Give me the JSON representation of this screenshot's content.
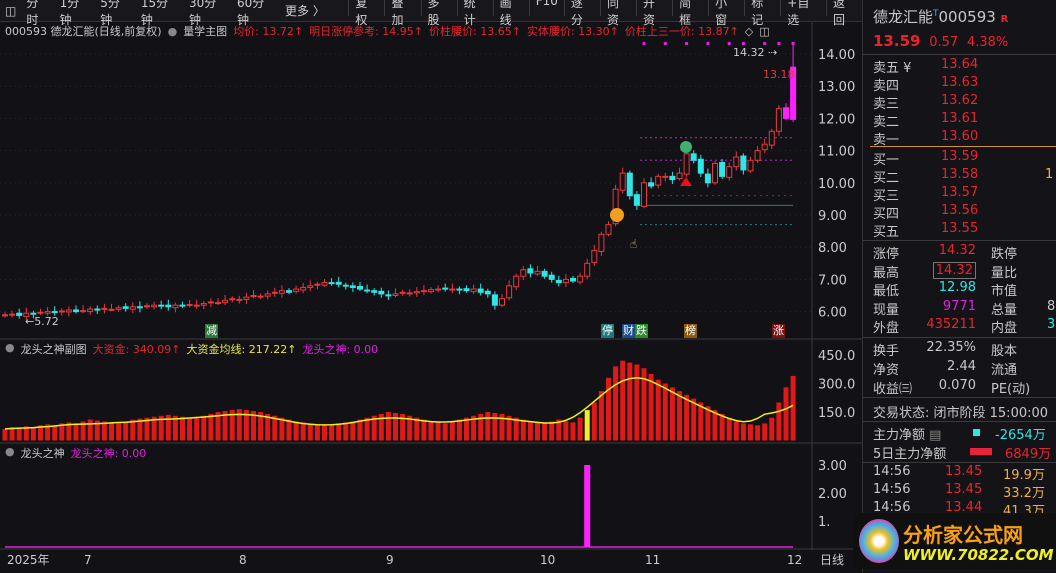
{
  "toolbar": {
    "items": [
      "分时",
      "1分钟",
      "5分钟",
      "15分钟",
      "30分钟",
      "60分钟"
    ],
    "more": "更多 〉",
    "tools": [
      "复权",
      "叠加",
      "多股",
      "统计",
      "画线",
      "F10",
      "逐分",
      "同资",
      "开资",
      "简框",
      "小窗",
      "标记",
      "+自选",
      "返回"
    ]
  },
  "info": {
    "title": "000593 德龙汇能(日线,前复权)",
    "indicator": "量学主图",
    "avg": "均价: 13.72↑",
    "limit_ref": "明日涨停参考: 14.95↑",
    "waist": "价柱腰价: 13.65↑",
    "body_waist": "实体腰价: 13.30↑",
    "top_third": "价柱上三一价: 13.87↑"
  },
  "main_chart": {
    "y_ticks": [
      "14.00",
      "13.00",
      "12.00",
      "11.00",
      "10.00",
      "9.00",
      "8.00",
      "7.00",
      "6.00"
    ],
    "high_label": "14.32",
    "last_label": "13.18",
    "low_label": "←5.72",
    "badges": [
      {
        "t": "减",
        "c": "#2a7a3a"
      },
      {
        "t": "停",
        "c": "#1a7a7a"
      },
      {
        "t": "财",
        "c": "#1a4a8a"
      },
      {
        "t": "跌",
        "c": "#2a8a2a"
      },
      {
        "t": "榜",
        "c": "#8a5a10"
      },
      {
        "t": "涨",
        "c": "#7a1010"
      }
    ],
    "closes": [
      5.9,
      5.92,
      5.88,
      5.95,
      5.93,
      5.98,
      6.0,
      5.97,
      6.02,
      6.05,
      6.0,
      6.03,
      6.08,
      6.05,
      6.1,
      6.07,
      6.12,
      6.1,
      6.15,
      6.12,
      6.18,
      6.2,
      6.17,
      6.15,
      6.2,
      6.18,
      6.22,
      6.2,
      6.25,
      6.3,
      6.28,
      6.35,
      6.4,
      6.38,
      6.45,
      6.5,
      6.48,
      6.55,
      6.6,
      6.65,
      6.6,
      6.7,
      6.75,
      6.8,
      6.85,
      6.9,
      6.88,
      6.85,
      6.8,
      6.75,
      6.7,
      6.65,
      6.6,
      6.55,
      6.5,
      6.55,
      6.6,
      6.58,
      6.62,
      6.65,
      6.68,
      6.7,
      6.72,
      6.7,
      6.68,
      6.65,
      6.7,
      6.6,
      6.55,
      6.2,
      6.4,
      6.8,
      7.1,
      7.3,
      7.2,
      7.25,
      7.1,
      7.0,
      6.9,
      7.0,
      6.95,
      7.1,
      7.5,
      7.9,
      8.4,
      8.7,
      9.8,
      10.3,
      9.6,
      9.3,
      10.0,
      9.9,
      10.2,
      10.2,
      10.1,
      10.3,
      10.9,
      10.7,
      10.3,
      10.0,
      10.6,
      10.2,
      10.5,
      10.8,
      10.4,
      10.7,
      11.0,
      11.2,
      11.6,
      12.3,
      12.0,
      13.59
    ]
  },
  "sub1": {
    "title": "龙头之神副图",
    "big_fund": "大资金: 340.09↑",
    "big_fund_ma": "大资金均线: 217.22↑",
    "dragon": "龙头之神: 0.00",
    "y_ticks": [
      "450.0",
      "300.0",
      "150.0"
    ],
    "highlight_index": 82,
    "values": [
      60,
      70,
      65,
      75,
      70,
      80,
      85,
      80,
      90,
      95,
      90,
      100,
      110,
      105,
      100,
      95,
      90,
      100,
      110,
      115,
      120,
      125,
      130,
      135,
      130,
      125,
      120,
      125,
      130,
      140,
      150,
      155,
      160,
      165,
      160,
      155,
      150,
      140,
      130,
      120,
      110,
      100,
      95,
      90,
      85,
      80,
      85,
      90,
      95,
      100,
      110,
      120,
      130,
      140,
      150,
      145,
      140,
      130,
      120,
      110,
      100,
      95,
      90,
      100,
      110,
      120,
      130,
      140,
      150,
      145,
      140,
      130,
      120,
      110,
      100,
      95,
      90,
      100,
      110,
      100,
      95,
      120,
      150,
      200,
      260,
      330,
      390,
      420,
      410,
      400,
      380,
      350,
      320,
      300,
      280,
      260,
      240,
      220,
      200,
      180,
      160,
      140,
      120,
      100,
      90,
      85,
      80,
      90,
      120,
      200,
      280,
      340
    ]
  },
  "sub2": {
    "title": "龙头之神",
    "dragon": "龙头之神: 0.00",
    "y_ticks": [
      "3.00",
      "2.00",
      "1."
    ],
    "spike_index": 82,
    "spike_value": 3
  },
  "xaxis": {
    "labels": [
      "2025年",
      "7",
      "8",
      "9",
      "10",
      "11",
      "12"
    ],
    "corner": "日线"
  },
  "panel": {
    "name": "德龙汇能",
    "t": "T",
    "code": "000593",
    "r": "R",
    "price": "13.59",
    "change": "0.57",
    "pct": "4.38%",
    "asks": [
      {
        "l": "卖五 ¥",
        "p": "13.64"
      },
      {
        "l": "卖四",
        "p": "13.63"
      },
      {
        "l": "卖三",
        "p": "13.62"
      },
      {
        "l": "卖二",
        "p": "13.61"
      },
      {
        "l": "卖一",
        "p": "13.60"
      }
    ],
    "bids": [
      {
        "l": "买一",
        "p": "13.59",
        "v": ""
      },
      {
        "l": "买二",
        "p": "13.58",
        "v": "1"
      },
      {
        "l": "买三",
        "p": "13.57",
        "v": ""
      },
      {
        "l": "买四",
        "p": "13.56",
        "v": ""
      },
      {
        "l": "买五",
        "p": "13.55",
        "v": ""
      }
    ],
    "stats": [
      {
        "l": "涨停",
        "v": "14.32",
        "l2": "跌停",
        "v2": ""
      },
      {
        "l": "最高",
        "v": "14.32",
        "l2": "量比",
        "v2": ""
      },
      {
        "l": "最低",
        "v": "12.98",
        "l2": "市值",
        "v2": ""
      },
      {
        "l": "现量",
        "v": "9771",
        "l2": "总量",
        "v2": "8"
      },
      {
        "l": "外盘",
        "v": "435211",
        "l2": "内盘",
        "v2": "3"
      }
    ],
    "fund": [
      {
        "l": "换手",
        "v": "22.35%",
        "l2": "股本"
      },
      {
        "l": "净资",
        "v": "2.44",
        "l2": "流通"
      },
      {
        "l": "收益㈢",
        "v": "0.070",
        "l2": "PE(动)"
      }
    ],
    "status": "交易状态: 闭市阶段 15:00:00",
    "main_net_label": "主力净额",
    "main_net": "-2654万",
    "five_net_label": "5日主力净额",
    "five_net": "6849万",
    "trades": [
      {
        "t": "14:56",
        "p": "13.45",
        "v": "19.9万"
      },
      {
        "t": "14:56",
        "p": "13.45",
        "v": "33.2万"
      },
      {
        "t": "14:56",
        "p": "13.44",
        "v": "41.3万"
      }
    ],
    "watermark": "分析家公式网",
    "watermark_url": "WWW.70822.COM"
  }
}
